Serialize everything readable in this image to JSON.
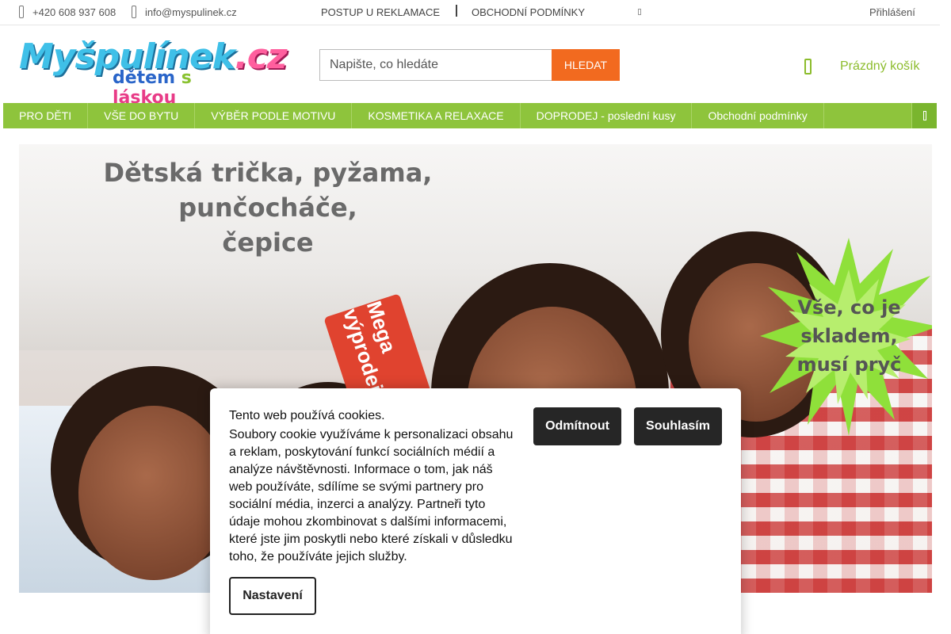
{
  "topbar": {
    "phone": "+420 608 937 608",
    "email": "info@myspulinek.cz",
    "links": [
      "POSTUP U REKLAMACE",
      "OBCHODNÍ PODMÍNKY"
    ],
    "login": "Přihlášení"
  },
  "logo": {
    "name": "Myšpulínek",
    "tld": ".cz",
    "tagline_parts": [
      "dětem",
      "s",
      "láskou"
    ]
  },
  "search": {
    "placeholder": "Napište, co hledáte",
    "button": "HLEDAT"
  },
  "cart": {
    "label": "Prázdný košík"
  },
  "nav": {
    "items": [
      "PRO DĚTI",
      "VŠE DO BYTU",
      "VÝBĚR PODLE MOTIVU",
      "KOSMETIKA A RELAXACE",
      "DOPRODEJ - poslední kusy",
      "Obchodní podmínky"
    ]
  },
  "banner": {
    "headline_line1": "Dětská trička, pyžama, punčocháče,",
    "headline_line2": "čepice",
    "burst_line1": "Vše, co je",
    "burst_line2": "skladem,",
    "burst_line3": "musí pryč",
    "tag_text": "Mega výprodej"
  },
  "cookie": {
    "title": "Tento web používá cookies.",
    "text": "Soubory cookie využíváme k personalizaci obsahu a reklam, poskytování funkcí sociálních médií a analýze návštěvnosti. Informace o tom, jak náš web používáte, sdílíme se svými partnery pro sociální média, inzerci a analýzy. Partneři tyto údaje mohou zkombinovat s dalšími informacemi, které jste jim poskytli nebo které získali v důsledku toho, že používáte jejich služby.",
    "decline": "Odmítnout",
    "accept": "Souhlasím",
    "settings": "Nastavení"
  },
  "colors": {
    "nav_green": "#8ec43c",
    "search_orange": "#f26a1f",
    "cart_green": "#8cbc2c",
    "cookie_button_dark": "#262626"
  }
}
